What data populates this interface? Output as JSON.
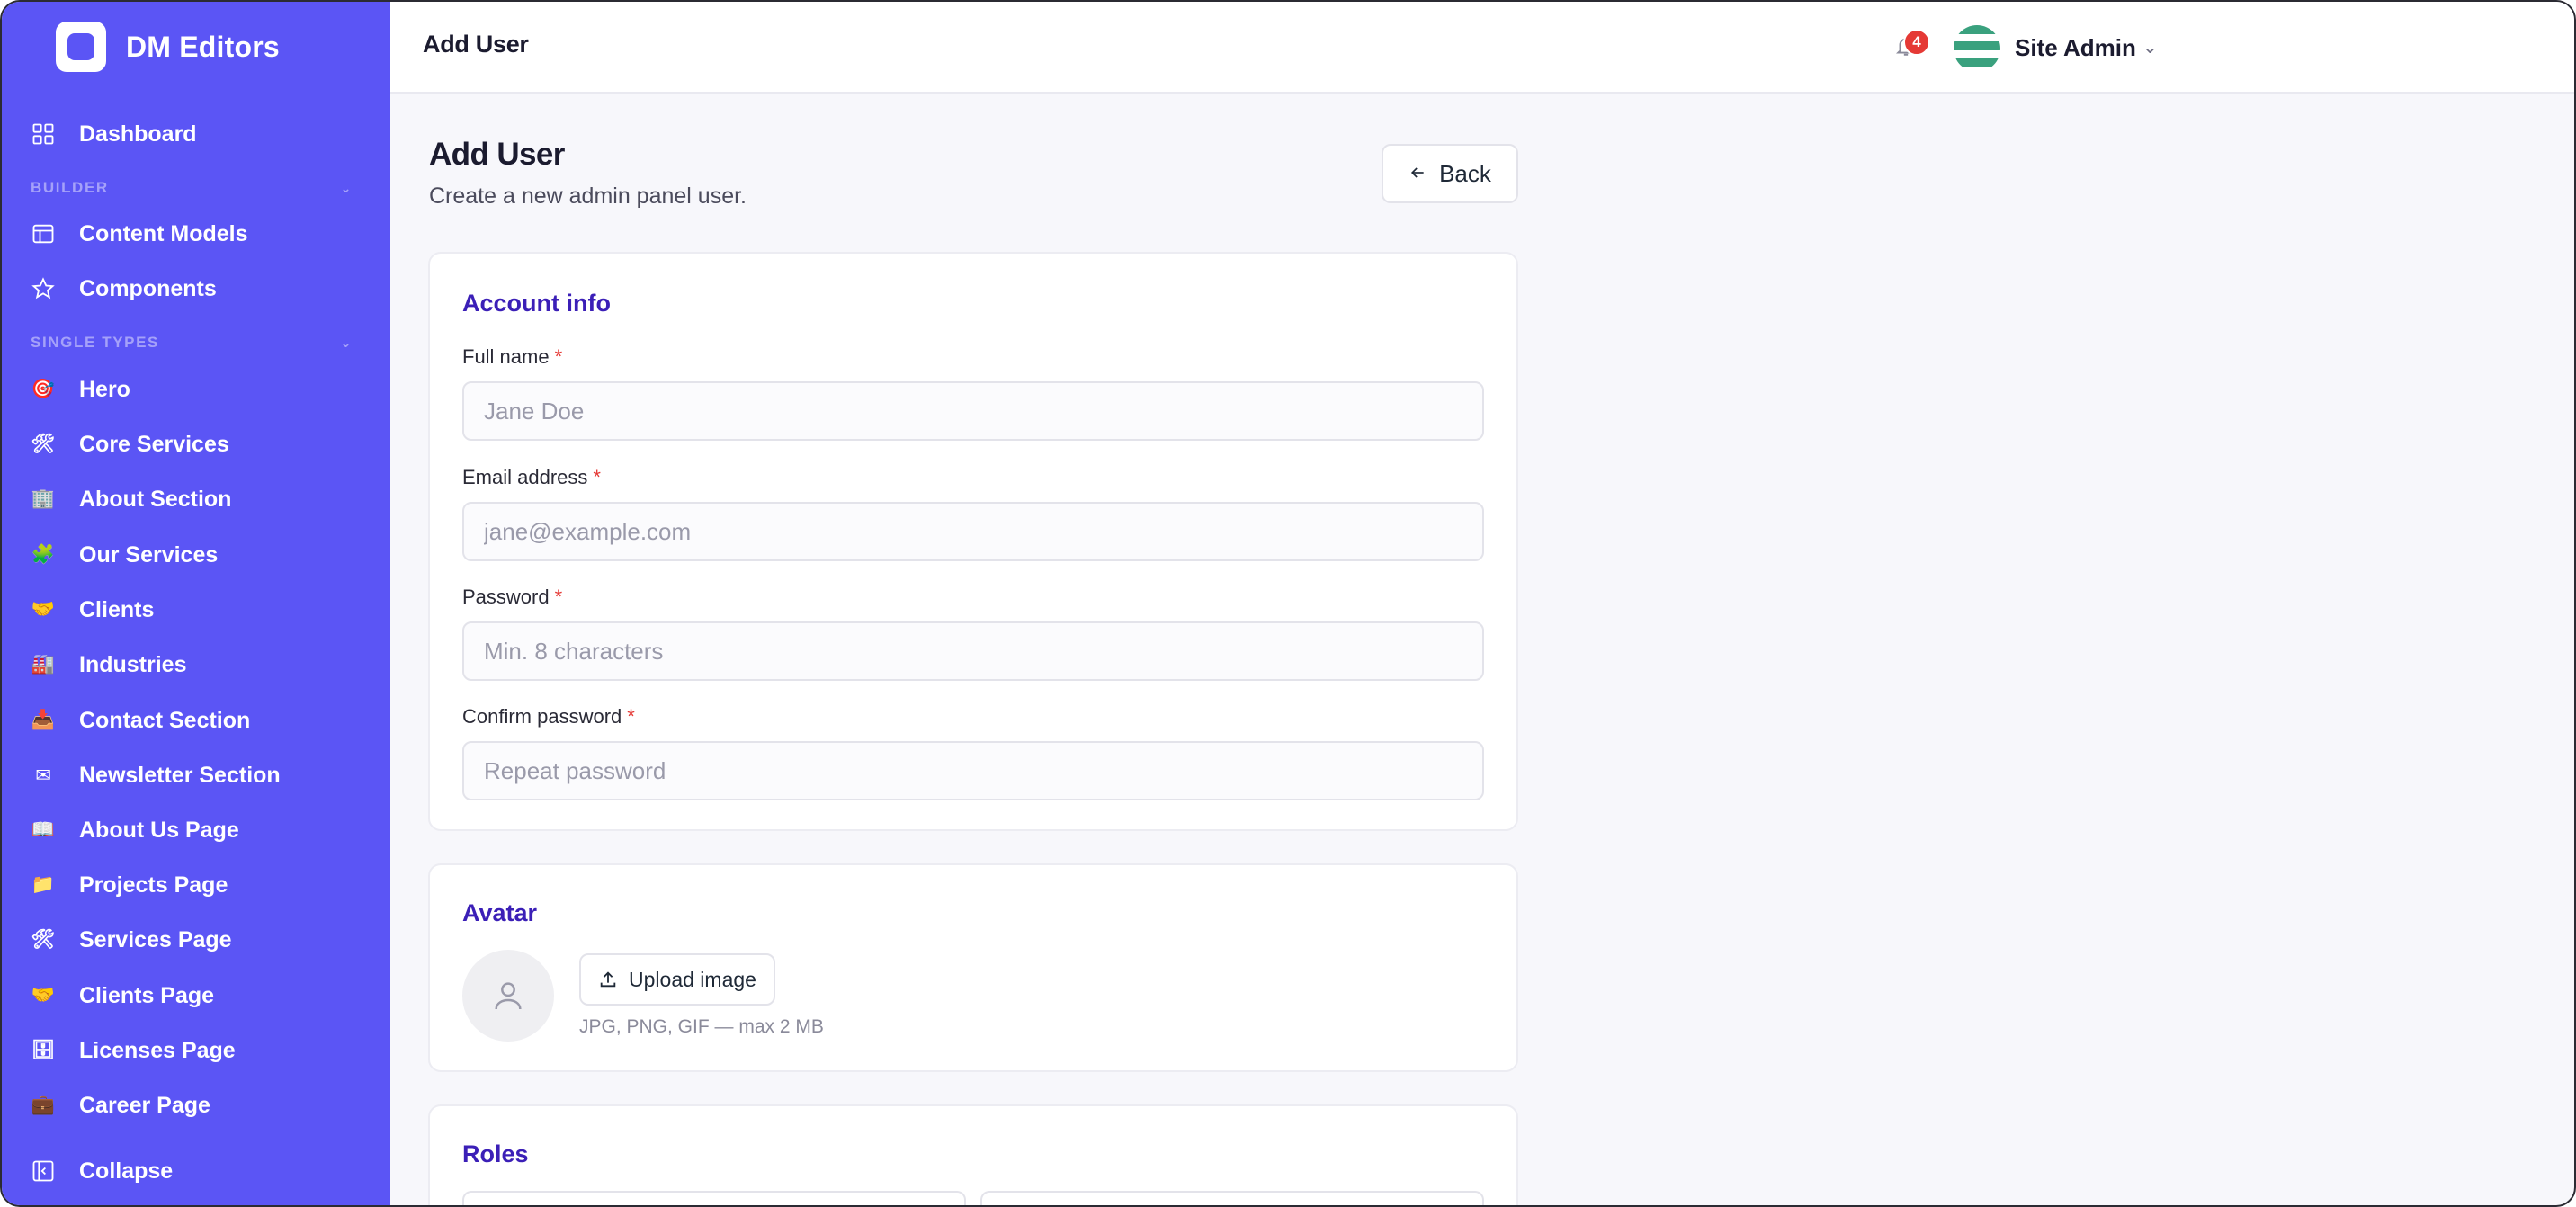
{
  "brand": {
    "name": "DM Editors"
  },
  "sidebar": {
    "dashboard": "Dashboard",
    "builder_label": "BUILDER",
    "builder_items": [
      {
        "label": "Content Models",
        "icon": "layout-icon"
      },
      {
        "label": "Components",
        "icon": "star-icon"
      }
    ],
    "single_types_label": "SINGLE TYPES",
    "single_types": [
      {
        "label": "Hero",
        "icon": "dart-icon",
        "glyph": "🎯"
      },
      {
        "label": "Core Services",
        "icon": "tools-icon",
        "glyph": "🛠"
      },
      {
        "label": "About Section",
        "icon": "building-icon",
        "glyph": "🏢"
      },
      {
        "label": "Our Services",
        "icon": "puzzle-icon",
        "glyph": "🧩"
      },
      {
        "label": "Clients",
        "icon": "handshake-icon",
        "glyph": "🤝"
      },
      {
        "label": "Industries",
        "icon": "factory-icon",
        "glyph": "🏭"
      },
      {
        "label": "Contact Section",
        "icon": "inbox-icon",
        "glyph": "📥"
      },
      {
        "label": "Newsletter Section",
        "icon": "envelope-icon",
        "glyph": "✉"
      },
      {
        "label": "About Us Page",
        "icon": "book-icon",
        "glyph": "📖"
      },
      {
        "label": "Projects Page",
        "icon": "folder-icon",
        "glyph": "📁"
      },
      {
        "label": "Services Page",
        "icon": "tools-icon",
        "glyph": "🛠"
      },
      {
        "label": "Clients Page",
        "icon": "handshake-icon",
        "glyph": "🤝"
      },
      {
        "label": "Licenses Page",
        "icon": "archive-icon",
        "glyph": "🗄"
      },
      {
        "label": "Career Page",
        "icon": "briefcase-icon",
        "glyph": "💼"
      }
    ],
    "collapse": "Collapse"
  },
  "topbar": {
    "title": "Add User",
    "notifications_count": "4",
    "user_name": "Site Admin"
  },
  "page": {
    "title": "Add User",
    "subtitle": "Create a new admin panel user.",
    "back_label": "Back"
  },
  "account_info": {
    "title": "Account info",
    "full_name": {
      "label": "Full name",
      "required": "*",
      "placeholder": "Jane Doe"
    },
    "email": {
      "label": "Email address",
      "required": "*",
      "placeholder": "jane@example.com"
    },
    "password": {
      "label": "Password",
      "required": "*",
      "placeholder": "Min. 8 characters"
    },
    "confirm_password": {
      "label": "Confirm password",
      "required": "*",
      "placeholder": "Repeat password"
    }
  },
  "avatar_card": {
    "title": "Avatar",
    "upload_label": "Upload image",
    "hint": "JPG, PNG, GIF — max 2 MB"
  },
  "roles_card": {
    "title": "Roles"
  },
  "colors": {
    "sidebar": "#5b55f5",
    "accent_title": "#3b1fb7",
    "required": "#e53935",
    "badge": "#e53935"
  }
}
